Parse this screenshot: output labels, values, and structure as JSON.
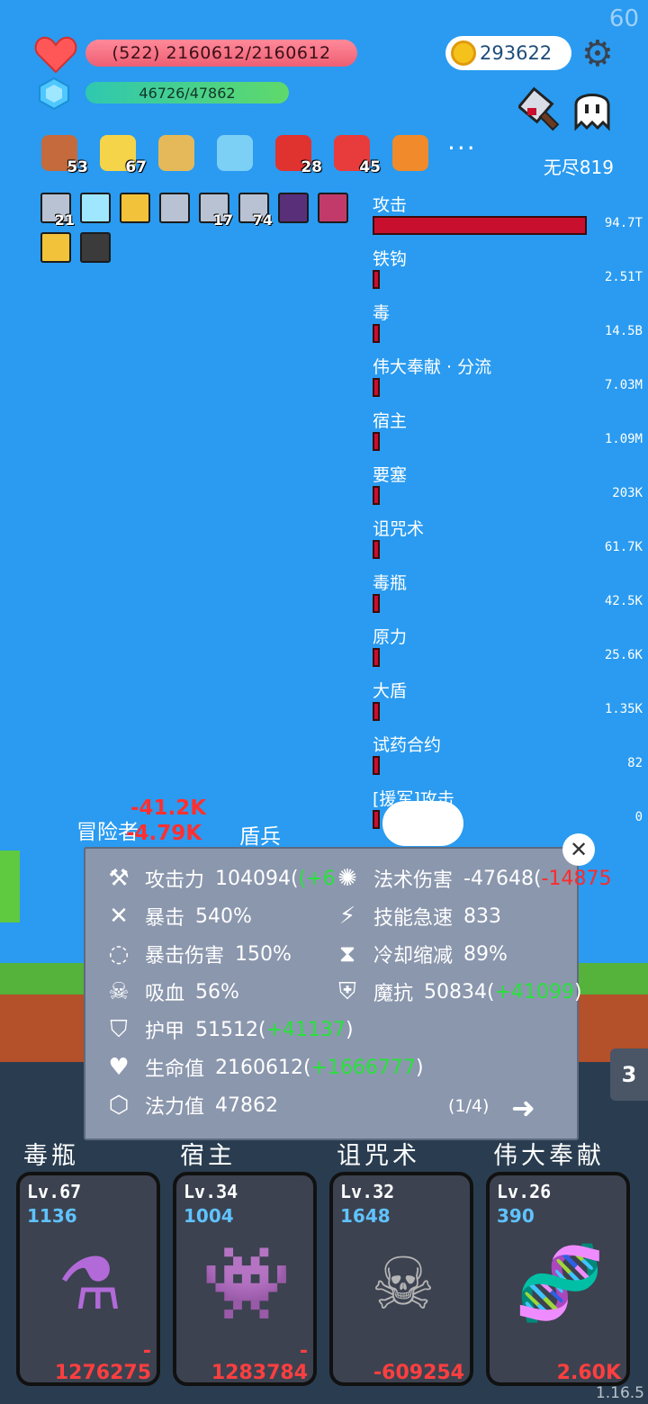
{
  "fps": "60",
  "player": {
    "hp_text": "(522) 2160612/2160612",
    "mp_text": "46726/47862",
    "coins": "293622",
    "endless": "无尽819"
  },
  "buffs": [
    {
      "icon": "eye-orb-icon",
      "count": "53",
      "color": "#c46a3c"
    },
    {
      "icon": "sun-icon",
      "count": "67",
      "color": "#f6d44a"
    },
    {
      "icon": "scroll-icon",
      "count": "",
      "color": "#e5b95a"
    },
    {
      "icon": "magnifier-icon",
      "count": "",
      "color": "#7ccff5"
    },
    {
      "icon": "mushroom-icon",
      "count": "28",
      "color": "#e0322f"
    },
    {
      "icon": "potion-icon",
      "count": "45",
      "color": "#e83c3c"
    },
    {
      "icon": "torch-icon",
      "count": "",
      "color": "#f08a2a"
    }
  ],
  "more_label": "···",
  "items": [
    {
      "icon": "sword-icon",
      "count": "21",
      "color": "#b8c2d2"
    },
    {
      "icon": "lightbulb-icon",
      "count": "",
      "color": "#9fe7ff"
    },
    {
      "icon": "armor-icon",
      "count": "",
      "color": "#f2c23a"
    },
    {
      "icon": "sword-icon",
      "count": "",
      "color": "#b8c2d2"
    },
    {
      "icon": "sword-icon",
      "count": "17",
      "color": "#b8c2d2"
    },
    {
      "icon": "sword-icon",
      "count": "74",
      "color": "#b8c2d2"
    },
    {
      "icon": "demon-icon",
      "count": "",
      "color": "#5a2f7a"
    },
    {
      "icon": "rune-icon",
      "count": "",
      "color": "#c23a6a"
    },
    {
      "icon": "armor-icon",
      "count": "",
      "color": "#f2c23a"
    },
    {
      "icon": "dark-armor-icon",
      "count": "",
      "color": "#3b3b3b"
    }
  ],
  "damage": [
    {
      "label": "攻击",
      "value": "94.7T",
      "ratio": 1.0
    },
    {
      "label": "铁钩",
      "value": "2.51T",
      "ratio": 0.027
    },
    {
      "label": "毒",
      "value": "14.5B",
      "ratio": 0.01
    },
    {
      "label": "伟大奉献 · 分流",
      "value": "7.03M",
      "ratio": 0.01
    },
    {
      "label": "宿主",
      "value": "1.09M",
      "ratio": 0.01
    },
    {
      "label": "要塞",
      "value": "203K",
      "ratio": 0.01
    },
    {
      "label": "诅咒术",
      "value": "61.7K",
      "ratio": 0.01
    },
    {
      "label": "毒瓶",
      "value": "42.5K",
      "ratio": 0.01
    },
    {
      "label": "原力",
      "value": "25.6K",
      "ratio": 0.01
    },
    {
      "label": "大盾",
      "value": "1.35K",
      "ratio": 0.01
    },
    {
      "label": "试药合约",
      "value": "82",
      "ratio": 0.01
    },
    {
      "label": "[援军]攻击",
      "value": "0",
      "ratio": 0.01
    }
  ],
  "battle": {
    "floats_label": "冒险者",
    "dmg1": "-41.2K",
    "dmg2": "-4.79K",
    "shield_label": "盾兵"
  },
  "stats": {
    "attack": {
      "key": "攻击力",
      "val": "104094",
      "extra": "(+6",
      "tail": "0"
    },
    "crit": {
      "key": "暴击",
      "val": "540%"
    },
    "crit_dmg": {
      "key": "暴击伤害",
      "val": "150%"
    },
    "lifesteal": {
      "key": "吸血",
      "val": "56%"
    },
    "armor": {
      "key": "护甲",
      "val": "51512",
      "paren_open": "(",
      "extra": "+41137",
      "paren_close": ")"
    },
    "hp": {
      "key": "生命值",
      "val": "2160612",
      "paren_open": "(",
      "extra": "+1666777",
      "paren_close": ")"
    },
    "mana": {
      "key": "法力值",
      "val": "47862"
    },
    "spell": {
      "key": "法术伤害",
      "val": "-47648",
      "paren_open": "(",
      "extra": "-14875"
    },
    "haste": {
      "key": "技能急速",
      "val": "833"
    },
    "cdr": {
      "key": "冷却缩减",
      "val": "89%"
    },
    "mres": {
      "key": "魔抗",
      "val": "50834",
      "paren_open": "(",
      "extra": "+41099",
      "paren_close": ")"
    }
  },
  "pager": "(1/4)",
  "side_tab": "3",
  "cards": [
    {
      "title": "毒瓶",
      "lv": "Lv.67",
      "cost": "1136",
      "dmg_sign": "-",
      "dmg": "1276275",
      "icon": "poison-bottle-icon"
    },
    {
      "title": "宿主",
      "lv": "Lv.34",
      "cost": "1004",
      "dmg_sign": "-",
      "dmg": "1283784",
      "icon": "germ-host-icon"
    },
    {
      "title": "诅咒术",
      "lv": "Lv.32",
      "cost": "1648",
      "dmg_sign": "",
      "dmg": "-609254",
      "icon": "skull-icon"
    },
    {
      "title": "伟大奉献",
      "lv": "Lv.26",
      "cost": "390",
      "dmg_sign": "",
      "dmg": "2.60K",
      "icon": "dna-icon"
    }
  ],
  "version": "1.16.5"
}
